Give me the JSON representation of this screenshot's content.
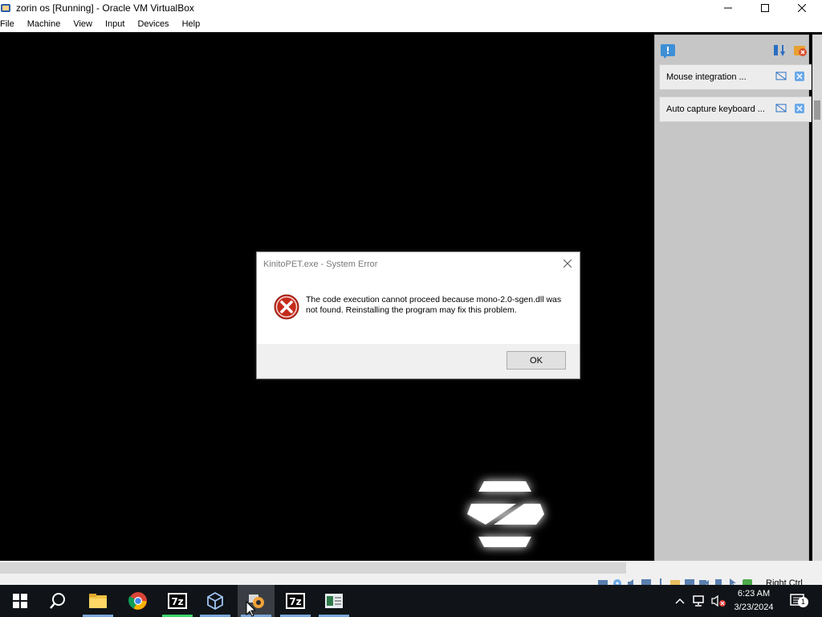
{
  "window": {
    "title": "zorin os [Running] - Oracle VM VirtualBox",
    "icon": "virtualbox-icon",
    "controls": [
      "minimize-icon",
      "maximize-icon",
      "close-icon"
    ]
  },
  "menubar": {
    "items": [
      {
        "label": "File"
      },
      {
        "label": "Machine"
      },
      {
        "label": "View"
      },
      {
        "label": "Input"
      },
      {
        "label": "Devices"
      },
      {
        "label": "Help"
      }
    ]
  },
  "dialog": {
    "title": "KinitoPET.exe - System Error",
    "message": "The code execution cannot proceed because mono-2.0-sgen.dll was not found. Reinstalling the program may fix this problem.",
    "icon": "error-icon",
    "ok_label": "OK"
  },
  "notification_panel": {
    "header_icon": "notification-center-icon",
    "items": [
      {
        "text": "Mouse integration ..."
      },
      {
        "text": "Auto capture keyboard ..."
      }
    ]
  },
  "statusbar": {
    "host_key": "Right Ctrl"
  },
  "taskbar": {
    "apps": [
      {
        "name": "start"
      },
      {
        "name": "search"
      },
      {
        "name": "file-explorer"
      },
      {
        "name": "chrome"
      },
      {
        "name": "7zip"
      },
      {
        "name": "virtualbox"
      },
      {
        "name": "virtualbox-vm"
      },
      {
        "name": "7zip-2"
      },
      {
        "name": "notepad-app"
      }
    ],
    "clock": {
      "time": "6:23 AM",
      "date": "3/23/2024"
    },
    "notification_count": "1"
  },
  "colors": {
    "taskbar_bg": "#101418",
    "error_red": "#c42b1c",
    "vm_bg": "#000000",
    "dialog_footer": "#f0f0f0"
  }
}
